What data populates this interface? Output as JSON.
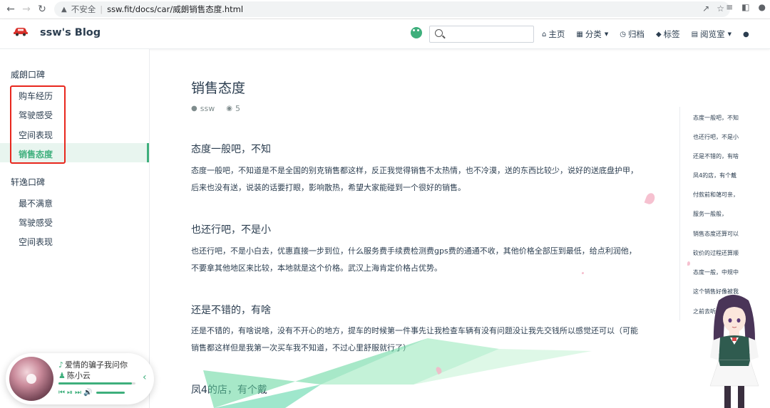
{
  "browser": {
    "insecure_label": "不安全",
    "url": "ssw.fit/docs/car/威朗销售态度.html"
  },
  "site": {
    "name": "ssw's Blog",
    "search_placeholder": "",
    "nav": [
      {
        "label": "主页",
        "icon": "home-icon"
      },
      {
        "label": "分类",
        "icon": "grid-icon",
        "dropdown": true
      },
      {
        "label": "归档",
        "icon": "clock-icon"
      },
      {
        "label": "标签",
        "icon": "tag-icon"
      },
      {
        "label": "阅览室",
        "icon": "book-icon",
        "dropdown": true
      }
    ]
  },
  "sidebar": {
    "groups": [
      {
        "title": "威朗口碑",
        "items": [
          "购车经历",
          "驾驶感受",
          "空间表现",
          "销售态度"
        ]
      },
      {
        "title": "轩逸口碑",
        "items": [
          "最不满意",
          "驾驶感受",
          "空间表现"
        ]
      }
    ],
    "active_item": "销售态度"
  },
  "player": {
    "song": "爱情的骗子我问你",
    "artist": "陈小云",
    "progress": 0.95
  },
  "article": {
    "title": "销售态度",
    "author": "ssw",
    "views": "5",
    "sections": [
      {
        "heading": "态度一般吧，不知",
        "body": "态度一般吧，不知道是不是全国的别克销售都这样，反正我觉得销售不太热情，也不冷漠，送的东西比较少，说好的送底盘护甲，后来也没有送，说装的话要打眼，影响散热，希望大家能碰到一个很好的销售。"
      },
      {
        "heading": "也还行吧，不是小",
        "body": "也还行吧，不是小白去，优惠直接一步到位，什么服务费手续费检测费gps费的通通不收，其他价格全部压到最低，给点利润他，不要拿其他地区来比较，本地就是这个价格。武汉上海肯定价格占优势。"
      },
      {
        "heading": "还是不错的，有啥",
        "body": "还是不错的，有啥说啥，没有不开心的地方，提车的时候第一件事先让我检查车辆有没有问题没让我先交钱所以感觉还可以（可能销售都这样但是我第一次买车我不知道，不过心里舒服就行了）"
      },
      {
        "heading": "凤4的店，有个戴",
        "body": ""
      }
    ]
  },
  "toc": [
    "态度一般吧，不知",
    "也还行吧，不是小",
    "还是不错的，有啥",
    "凤4的店，有个戴",
    "付款前和蔼可亲，",
    "服务一般般，",
    "销售态度还算可以",
    "砍价的过程还算顺",
    "态度一般，中规中",
    "这个销售好像被我",
    "之前去听"
  ],
  "colors": {
    "accent": "#3eaf7c",
    "highlight_box": "#e8271d"
  }
}
